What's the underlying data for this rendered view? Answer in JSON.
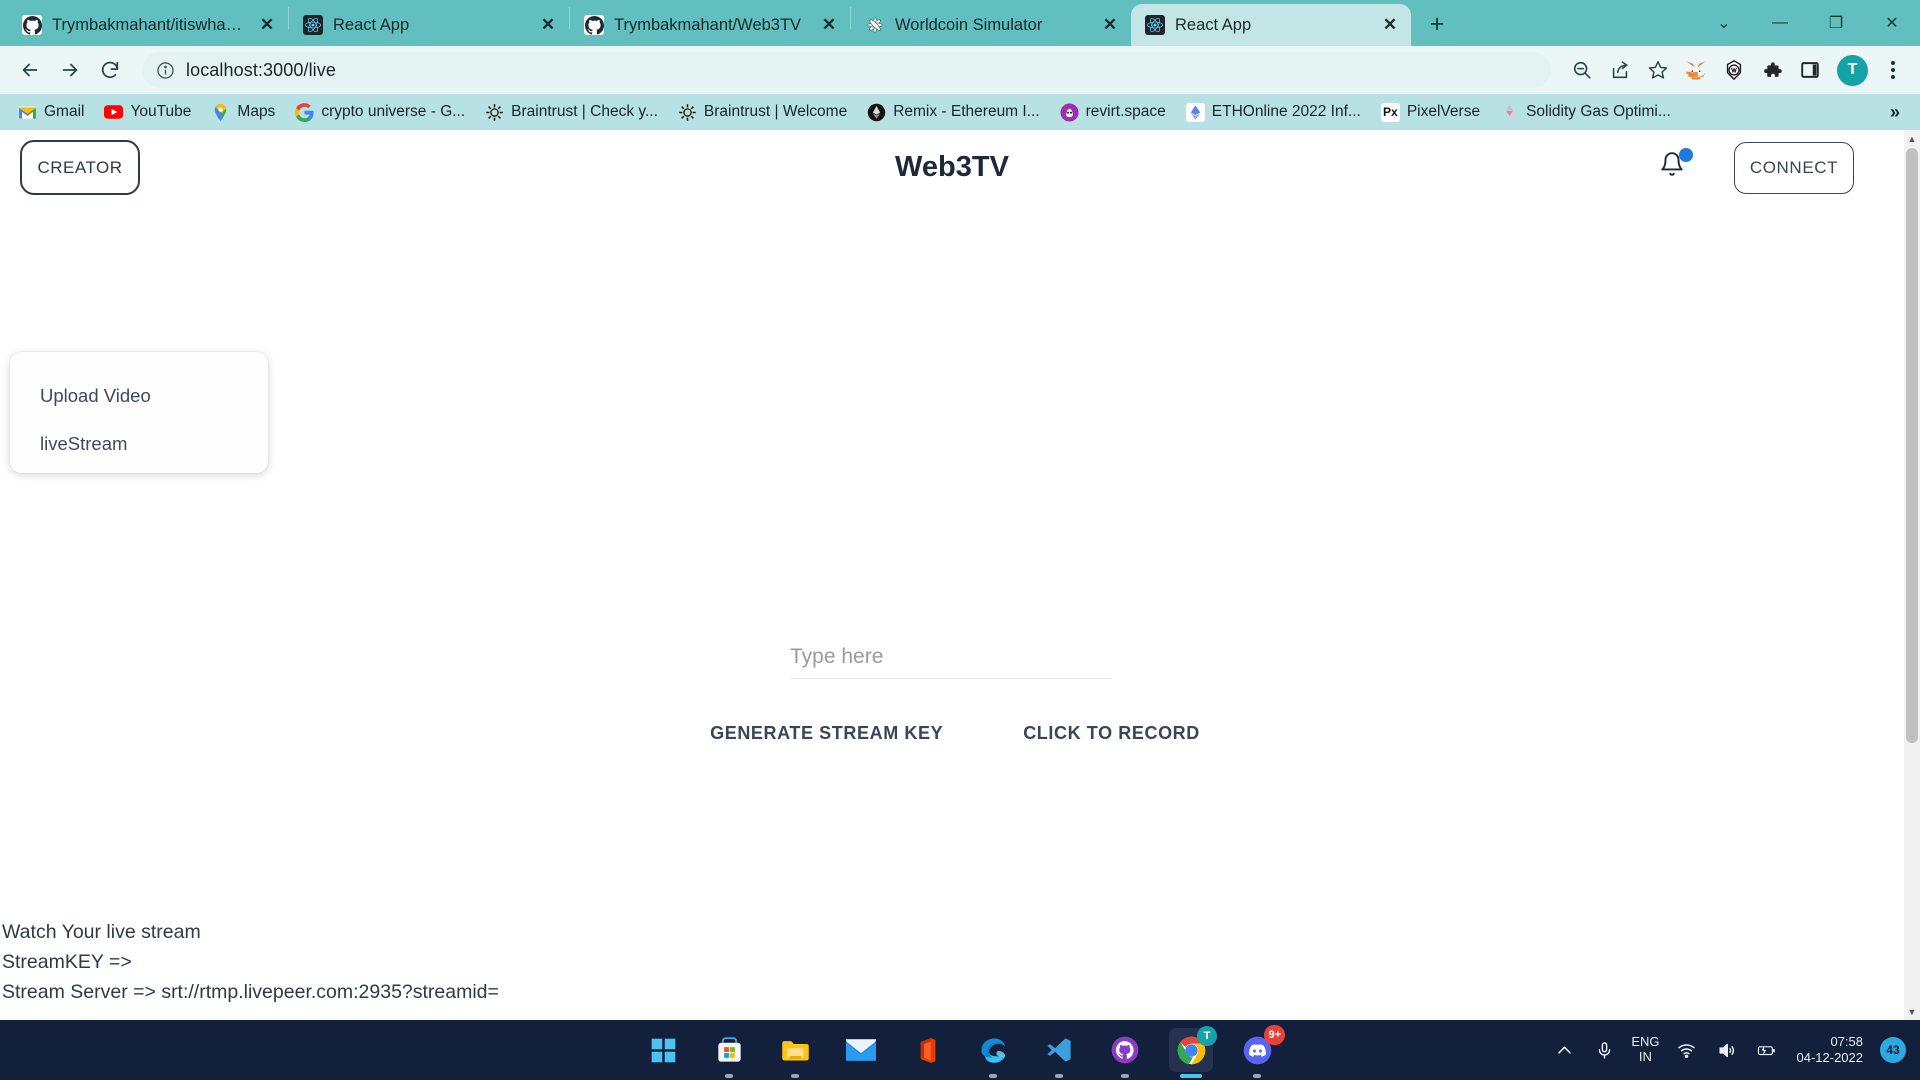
{
  "browser": {
    "tabs": [
      {
        "title": "Trymbakmahant/itiswhatitis",
        "icon": "github-icon",
        "active": false
      },
      {
        "title": "React App",
        "icon": "react-icon",
        "active": false
      },
      {
        "title": "Trymbakmahant/Web3TV",
        "icon": "github-icon",
        "active": false
      },
      {
        "title": "Worldcoin Simulator",
        "icon": "worldcoin-icon",
        "active": false
      },
      {
        "title": "React App",
        "icon": "react-icon",
        "active": true
      }
    ],
    "new_tab_label": "+",
    "window_controls": {
      "restore": "⌄",
      "minimize": "—",
      "maximize": "❐",
      "close": "✕"
    },
    "toolbar": {
      "back_icon": "back-arrow-icon",
      "forward_icon": "forward-arrow-icon",
      "reload_icon": "reload-icon",
      "site_info_icon": "info-icon",
      "url_host": "localhost:3000",
      "url_path": "/live",
      "url_full": "localhost:3000/live",
      "zoom_out_icon": "zoom-out-icon",
      "share_icon": "share-icon",
      "bookmark_icon": "star-icon",
      "extensions": [
        "metamask-icon",
        "worldcoin-ext-icon",
        "puzzle-icon",
        "sidepanel-icon"
      ],
      "profile_initial": "T",
      "menu_icon": "kebab-menu-icon"
    },
    "bookmarks": [
      {
        "label": "Gmail",
        "icon": "gmail-icon"
      },
      {
        "label": "YouTube",
        "icon": "youtube-icon"
      },
      {
        "label": "Maps",
        "icon": "maps-icon"
      },
      {
        "label": "crypto universe - G...",
        "icon": "google-icon"
      },
      {
        "label": "Braintrust | Check y...",
        "icon": "braintrust-icon"
      },
      {
        "label": "Braintrust | Welcome",
        "icon": "braintrust-icon"
      },
      {
        "label": "Remix - Ethereum I...",
        "icon": "ethereum-icon"
      },
      {
        "label": "revirt.space",
        "icon": "revirt-icon"
      },
      {
        "label": "ETHOnline 2022 Inf...",
        "icon": "ethonline-icon"
      },
      {
        "label": "PixelVerse",
        "icon": "pixelverse-icon"
      },
      {
        "label": "Solidity Gas Optimi...",
        "icon": "solidity-icon"
      }
    ],
    "bookmarks_overflow_label": "»"
  },
  "app": {
    "title": "Web3TV",
    "creator_button_label": "CREATOR",
    "connect_button_label": "CONNECT",
    "notification_icon": "bell-icon",
    "dropdown": {
      "items": [
        {
          "label": "Upload Video"
        },
        {
          "label": "liveStream"
        }
      ]
    },
    "form": {
      "input_value": "",
      "input_placeholder": "Type here",
      "generate_button_label": "GENERATE STREAM KEY",
      "record_button_label": "CLICK TO RECORD"
    },
    "stream_info": {
      "heading": "Watch Your live stream",
      "stream_key_line": "StreamKEY =>",
      "stream_server_line": "Stream Server => srt://rtmp.livepeer.com:2935?streamid="
    }
  },
  "taskbar": {
    "apps": [
      {
        "name": "start-windows-icon",
        "badge": ""
      },
      {
        "name": "microsoft-store-icon",
        "badge": ""
      },
      {
        "name": "file-explorer-icon",
        "badge": ""
      },
      {
        "name": "mail-icon",
        "badge": ""
      },
      {
        "name": "office-icon",
        "badge": ""
      },
      {
        "name": "edge-icon",
        "badge": ""
      },
      {
        "name": "vscode-icon",
        "badge": ""
      },
      {
        "name": "github-desktop-icon",
        "badge": ""
      },
      {
        "name": "chrome-icon",
        "badge": "T"
      },
      {
        "name": "discord-icon",
        "badge": "9+"
      }
    ],
    "tray": {
      "overflow_icon": "chevron-up-icon",
      "mic_icon": "microphone-icon",
      "language_primary": "ENG",
      "language_secondary": "IN",
      "wifi_icon": "wifi-icon",
      "volume_icon": "speaker-icon",
      "battery_icon": "battery-charging-icon",
      "time": "07:58",
      "date": "04-12-2022",
      "notification_count": "43"
    }
  },
  "colors": {
    "chrome_accent": "#6ec6c6",
    "tab_active": "#c3e5e5",
    "toolbar_bg": "#ebf7f7",
    "bookmarks_bg": "#b8e1e3",
    "app_text": "#1e2a3a",
    "taskbar_bg": "#13203c",
    "notification_dot": "#1f7ae0"
  }
}
